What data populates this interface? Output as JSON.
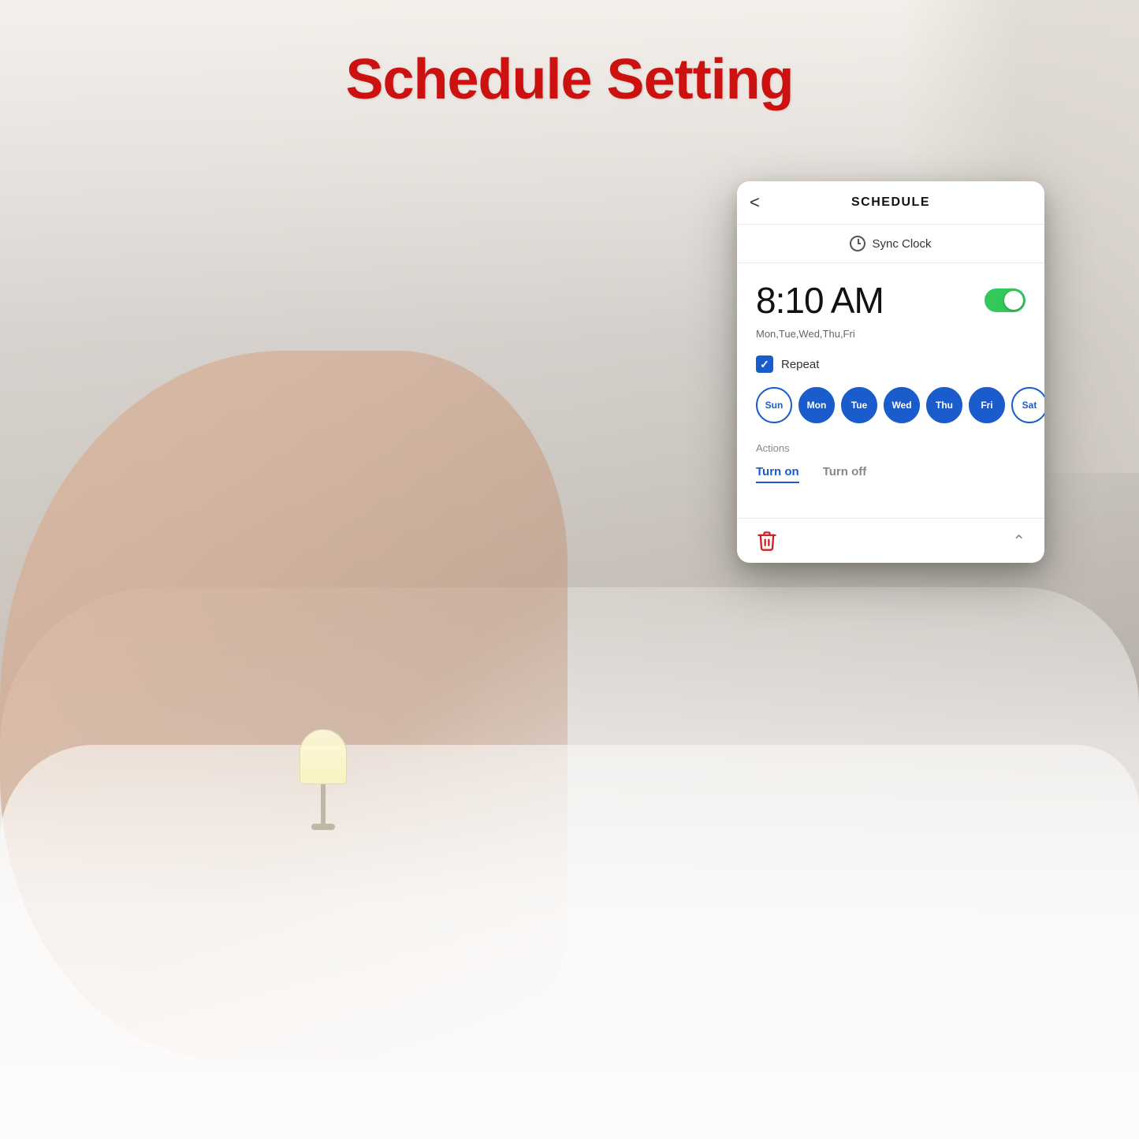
{
  "page": {
    "title": "Schedule Setting",
    "background_desc": "bedroom with sleeping woman"
  },
  "header": {
    "back_label": "<",
    "title": "SCHEDULE",
    "sync_clock_text": "Sync Clock",
    "sync_clock_icon": "clock-sync-icon"
  },
  "schedule": {
    "time": "8:10 AM",
    "days_summary": "Mon,Tue,Wed,Thu,Fri",
    "toggle_on": true,
    "repeat_label": "Repeat",
    "repeat_checked": true,
    "days": [
      {
        "label": "Sun",
        "active": false
      },
      {
        "label": "Mon",
        "active": true
      },
      {
        "label": "Tue",
        "active": true
      },
      {
        "label": "Wed",
        "active": true
      },
      {
        "label": "Thu",
        "active": true
      },
      {
        "label": "Fri",
        "active": true
      },
      {
        "label": "Sat",
        "active": false
      }
    ],
    "actions_label": "Actions",
    "turn_on_label": "Turn on",
    "turn_off_label": "Turn off",
    "turn_on_active": true
  },
  "colors": {
    "title_red": "#cc1111",
    "blue": "#1a5ccc",
    "green_toggle": "#34c759",
    "trash_red": "#cc2222"
  }
}
